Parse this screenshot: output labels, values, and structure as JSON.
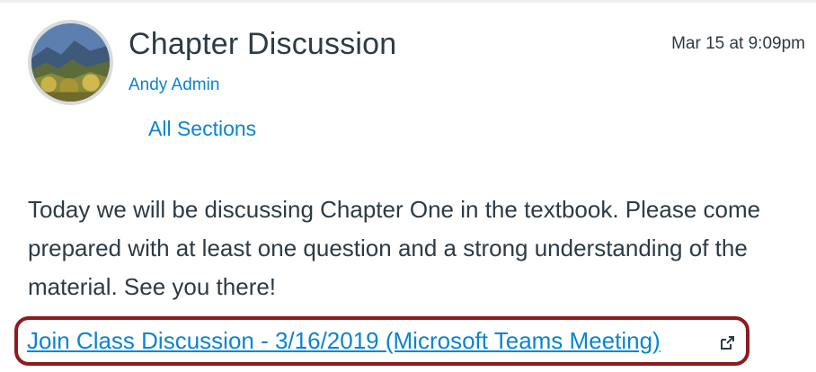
{
  "post": {
    "title": "Chapter Discussion",
    "author": "Andy Admin",
    "timestamp": "Mar 15 at 9:09pm",
    "sections_label": "All Sections",
    "message": "Today we will be discussing Chapter One in the textbook. Please come prepared with at least one question and a strong understanding of the material. See you there!",
    "link_text": "Join Class Discussion - 3/16/2019 (Microsoft Teams Meeting)",
    "link_icon": "external-link-icon"
  },
  "colors": {
    "link": "#0a84d0",
    "text": "#2d3b45",
    "highlight_border": "#8c1b1b"
  }
}
